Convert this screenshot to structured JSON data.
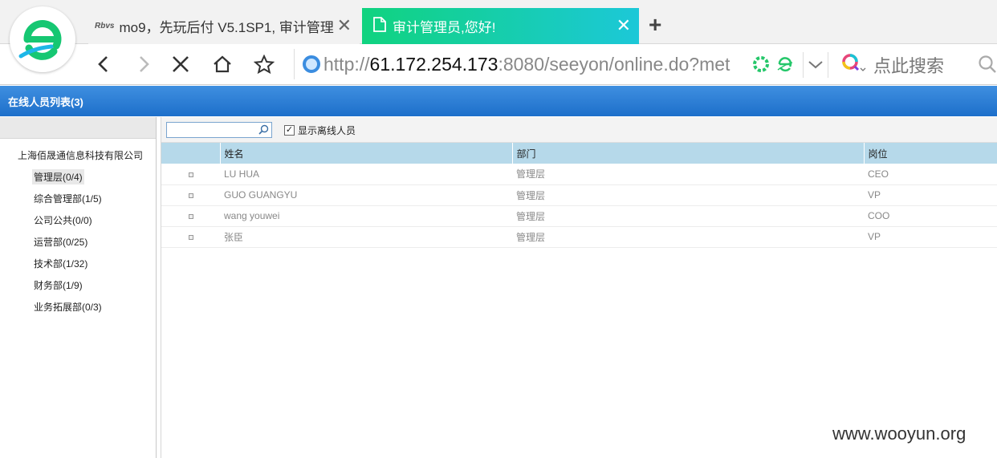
{
  "browser": {
    "tabs": [
      {
        "favicon": "Rbvs",
        "title": "mo9，先玩后付 V5.1SP1, 审计管理"
      },
      {
        "title": "审计管理员,您好!"
      }
    ],
    "url_prefix": "http://",
    "url_host": "61.172.254.173",
    "url_rest": ":8080/seeyon/online.do?met",
    "search_placeholder": "点此搜索",
    "accent": "#10d37f"
  },
  "app": {
    "header_title": "在线人员列表(3)",
    "search_placeholder": "",
    "show_offline_label": "显示离线人员",
    "show_offline_checked": true,
    "tree": {
      "root": "上海佰晟通信息科技有限公司",
      "nodes": [
        {
          "label": "管理层(0/4)",
          "selected": true
        },
        {
          "label": "综合管理部(1/5)"
        },
        {
          "label": "公司公共(0/0)"
        },
        {
          "label": "运营部(0/25)"
        },
        {
          "label": "技术部(1/32)"
        },
        {
          "label": "财务部(1/9)"
        },
        {
          "label": "业务拓展部(0/3)"
        }
      ]
    },
    "table": {
      "columns": [
        "",
        "姓名",
        "部门",
        "岗位"
      ],
      "rows": [
        [
          "",
          "LU HUA",
          "管理层",
          "CEO"
        ],
        [
          "",
          "GUO GUANGYU",
          "管理层",
          "VP"
        ],
        [
          "",
          "wang youwei",
          "管理层",
          "COO"
        ],
        [
          "",
          "张臣",
          "管理层",
          "VP"
        ]
      ]
    }
  },
  "watermark": "www.wooyun.org"
}
